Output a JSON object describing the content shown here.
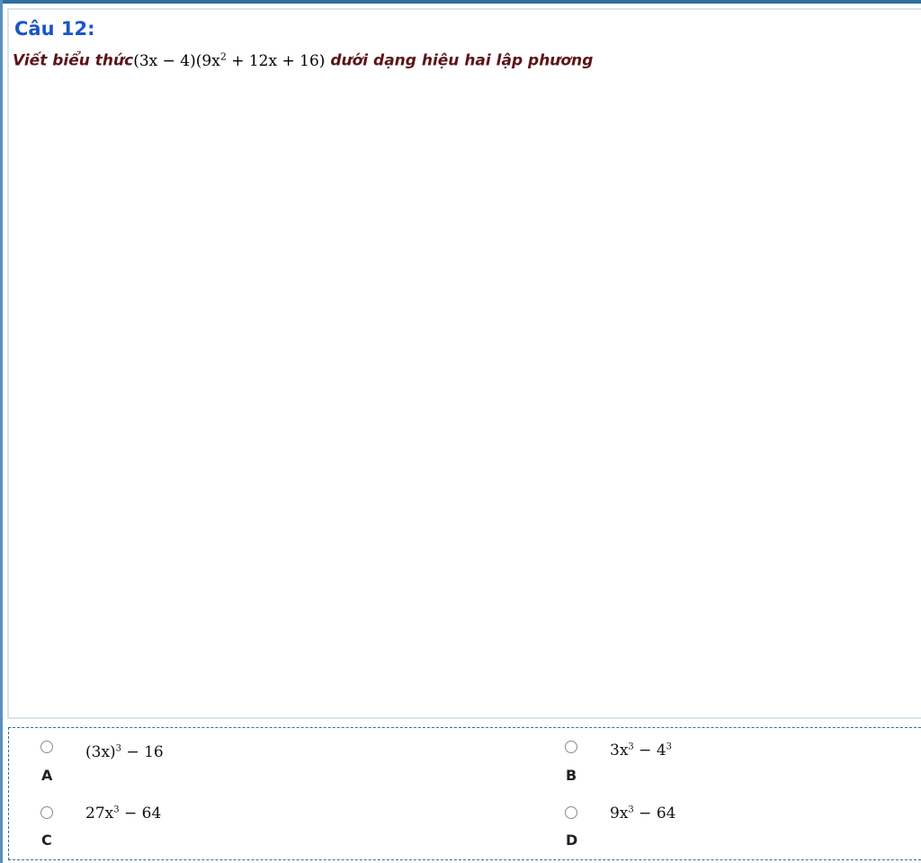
{
  "question": {
    "number": "Câu 12:",
    "prefix": "Viết biểu thức",
    "expression": {
      "p1": "(3x − 4)",
      "p2a": "(9x",
      "p2exp": "2",
      "p2b": " + 12x + 16)"
    },
    "suffix": " dưới dạng hiệu hai lập phương"
  },
  "options": [
    {
      "letter": "A",
      "expr": {
        "base": "(3x)",
        "exp": "3",
        "rest": " − 16"
      }
    },
    {
      "letter": "B",
      "expr": {
        "base": "3x",
        "exp": "3",
        "mid": " − 4",
        "exp2": "3"
      }
    },
    {
      "letter": "C",
      "expr": {
        "base": "27x",
        "exp": "3",
        "rest": " − 64"
      }
    },
    {
      "letter": "D",
      "expr": {
        "base": "9x",
        "exp": "3",
        "rest": " − 64"
      }
    }
  ]
}
